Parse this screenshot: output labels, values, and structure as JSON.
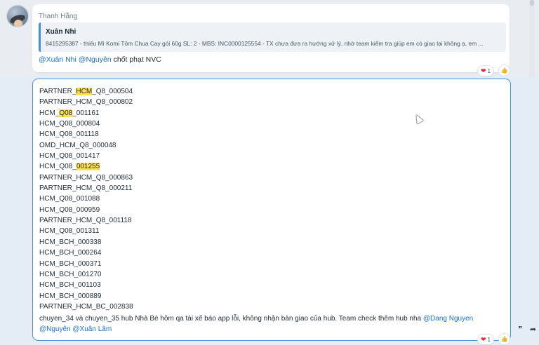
{
  "message1": {
    "sender": "Thanh Hằng",
    "quote_author": "Xuân Nhi",
    "quote_text": "8415295387 - thiếu Mì Komi Tôm Chua Cay gói 60g SL: 2 - MBS: INC0000125554 - TX chưa đưa ra hướng xử lý, nhờ team kiểm tra giúp em có giao lại không ạ, em ...",
    "mention1": "@Xuân Nhi",
    "mention2": "@Nguyên",
    "text": "chốt phạt NVC",
    "reaction_count": "1"
  },
  "message2": {
    "lines": [
      {
        "pre": "PARTNER_",
        "hl": "HCM",
        "post": "_Q8_000504"
      },
      {
        "pre": "PARTNER_HCM_Q8_000802",
        "hl": "",
        "post": ""
      },
      {
        "pre": "HCM_",
        "hl": "Q08",
        "post": "_001161"
      },
      {
        "pre": "HCM_Q08_000804",
        "hl": "",
        "post": ""
      },
      {
        "pre": "HCM_Q08_001118",
        "hl": "",
        "post": ""
      },
      {
        "pre": "OMD_HCM_Q8_000048",
        "hl": "",
        "post": ""
      },
      {
        "pre": "HCM_Q08_001417",
        "hl": "",
        "post": ""
      },
      {
        "pre": "HCM_Q08_",
        "hl": "001255",
        "post": ""
      },
      {
        "pre": "PARTNER_HCM_Q8_000863",
        "hl": "",
        "post": ""
      },
      {
        "pre": "PARTNER_HCM_Q8_000211",
        "hl": "",
        "post": ""
      },
      {
        "pre": "HCM_Q08_001088",
        "hl": "",
        "post": ""
      },
      {
        "pre": "HCM_Q08_000959",
        "hl": "",
        "post": ""
      },
      {
        "pre": "PARTNER_HCM_Q8_001118",
        "hl": "",
        "post": ""
      },
      {
        "pre": "HCM_Q08_001311",
        "hl": "",
        "post": ""
      },
      {
        "pre": "HCM_BCH_000338",
        "hl": "",
        "post": ""
      },
      {
        "pre": "HCM_BCH_000264",
        "hl": "",
        "post": ""
      },
      {
        "pre": "HCM_BCH_000371",
        "hl": "",
        "post": ""
      },
      {
        "pre": "HCM_BCH_001270",
        "hl": "",
        "post": ""
      },
      {
        "pre": "HCM_BCH_001103",
        "hl": "",
        "post": ""
      },
      {
        "pre": "HCM_BCH_000889",
        "hl": "",
        "post": ""
      },
      {
        "pre": "PARTNER_HCM_BC_002838",
        "hl": "",
        "post": ""
      }
    ],
    "note_text": "chuyen_34 và chuyen_35 hub Nhà Bè hôm qa tài xế báo app lỗi, không nhận bàn giao của hub. Team check thêm hub nha",
    "mention1": "@Dang Nguyen",
    "mention2": "@Nguyên",
    "mention3": "@Xuân Lâm",
    "reaction_count": "1"
  },
  "icons": {
    "heart": "heart-icon",
    "like": "thumbs-up-icon",
    "quote": "quote-icon",
    "share": "share-icon"
  },
  "colors": {
    "accent": "#4a90e2",
    "mention": "#1a6fd6",
    "highlight": "#ffe14d",
    "heart": "#e0283c"
  }
}
